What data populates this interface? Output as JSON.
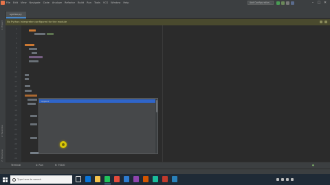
{
  "menubar": {
    "items": [
      "File",
      "Edit",
      "View",
      "Navigate",
      "Code",
      "Analyze",
      "Refactor",
      "Build",
      "Run",
      "Tools",
      "VCS",
      "Window",
      "Help"
    ],
    "window_title": "",
    "run_config_label": "Add Configuration...",
    "window_controls": [
      "–",
      "□",
      "✕"
    ]
  },
  "editor_tab": {
    "label": "syntax.py"
  },
  "banner": {
    "text": "No Python interpreter configured for the module"
  },
  "left_toolbar": {
    "labels": [
      "1: Project",
      "2: Favorites",
      "7: Structure"
    ]
  },
  "popup": {
    "items": [
      {
        "name": "append",
        "type": ""
      },
      {
        "name": "",
        "type": ""
      },
      {
        "name": "",
        "type": ""
      },
      {
        "name": "",
        "type": ""
      },
      {
        "name": "",
        "type": ""
      },
      {
        "name": "",
        "type": ""
      },
      {
        "name": "",
        "type": ""
      },
      {
        "name": "",
        "type": ""
      },
      {
        "name": "",
        "type": ""
      },
      {
        "name": "",
        "type": ""
      },
      {
        "name": "",
        "type": ""
      },
      {
        "name": "",
        "type": ""
      },
      {
        "name": "",
        "type": ""
      },
      {
        "name": "",
        "type": ""
      },
      {
        "name": "",
        "type": ""
      }
    ]
  },
  "bottom_tabs": {
    "items": [
      "Terminal",
      "4: Run",
      "6: TODO"
    ]
  },
  "statusbar": {
    "left": "",
    "right": [
      "",
      "",
      "",
      ""
    ]
  },
  "taskbar": {
    "search_placeholder": "Type here to search",
    "clock_time": "",
    "clock_date": ""
  },
  "colors": {
    "accent": "#2f65ca",
    "cursor_highlight": "#e8d400",
    "banner_bg": "#4a4a2e"
  }
}
